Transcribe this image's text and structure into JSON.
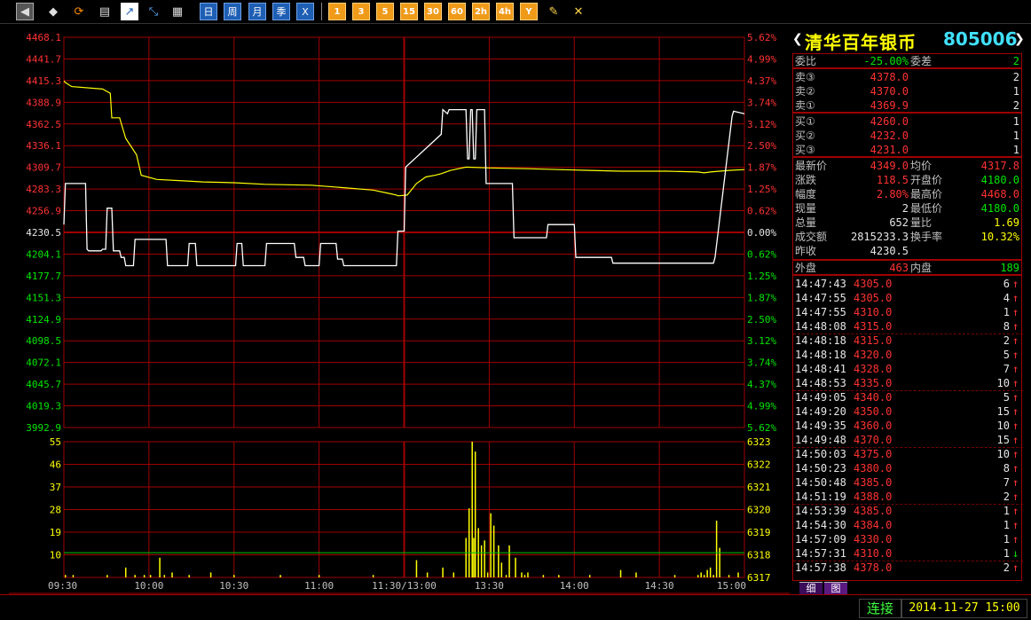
{
  "toolbar": {
    "icons": [
      "back-icon",
      "cube-icon",
      "refresh-icon",
      "clipboard-icon",
      "chart-icon",
      "compare-icon",
      "table-icon"
    ],
    "periods": [
      "日",
      "周",
      "月",
      "季",
      "X"
    ],
    "intervals": [
      "1",
      "3",
      "5",
      "15",
      "30",
      "60",
      "2h",
      "4h",
      "Y"
    ],
    "tools": [
      "pencil-icon",
      "tools-icon"
    ]
  },
  "stock": {
    "name": "清华百年银币",
    "code": "805006"
  },
  "orderbook": {
    "weibi_label": "委比",
    "weibi_value": "-25.00%",
    "weicha_label": "委差",
    "weicha_value": "2",
    "asks": [
      {
        "label": "卖③",
        "price": "4378.0",
        "qty": "2"
      },
      {
        "label": "卖②",
        "price": "4370.0",
        "qty": "1"
      },
      {
        "label": "卖①",
        "price": "4369.9",
        "qty": "2"
      }
    ],
    "bids": [
      {
        "label": "买①",
        "price": "4260.0",
        "qty": "1"
      },
      {
        "label": "买②",
        "price": "4232.0",
        "qty": "1"
      },
      {
        "label": "买③",
        "price": "4231.0",
        "qty": "1"
      }
    ]
  },
  "quote": {
    "rows": [
      {
        "l1": "最新价",
        "v1": "4349.0",
        "c1": "red",
        "l2": "均价",
        "v2": "4317.8",
        "c2": "red"
      },
      {
        "l1": "涨跌",
        "v1": "118.5",
        "c1": "red",
        "l2": "开盘价",
        "v2": "4180.0",
        "c2": "green"
      },
      {
        "l1": "幅度",
        "v1": "2.80%",
        "c1": "red",
        "l2": "最高价",
        "v2": "4468.0",
        "c2": "red"
      },
      {
        "l1": "现量",
        "v1": "2",
        "c1": "wht",
        "l2": "最低价",
        "v2": "4180.0",
        "c2": "green"
      },
      {
        "l1": "总量",
        "v1": "652",
        "c1": "wht",
        "l2": "量比",
        "v2": "1.69",
        "c2": "yel"
      },
      {
        "l1": "成交额",
        "v1": "2815233.3",
        "c1": "wht",
        "l2": "换手率",
        "v2": "10.32%",
        "c2": "yel"
      },
      {
        "l1": "昨收",
        "v1": "4230.5",
        "c1": "wht",
        "l2": "",
        "v2": "",
        "c2": "wht"
      }
    ],
    "waipan_label": "外盘",
    "waipan_value": "463",
    "neipan_label": "内盘",
    "neipan_value": "189"
  },
  "ticks": [
    {
      "time": "14:47:43",
      "price": "4305.0",
      "vol": "6",
      "dir": "↑"
    },
    {
      "time": "14:47:55",
      "price": "4305.0",
      "vol": "4",
      "dir": "↑"
    },
    {
      "time": "14:47:55",
      "price": "4310.0",
      "vol": "1",
      "dir": "↑"
    },
    {
      "time": "14:48:08",
      "price": "4315.0",
      "vol": "8",
      "dir": "↑"
    },
    {
      "time": "14:48:18",
      "price": "4315.0",
      "vol": "2",
      "dir": "↑"
    },
    {
      "time": "14:48:18",
      "price": "4320.0",
      "vol": "5",
      "dir": "↑"
    },
    {
      "time": "14:48:41",
      "price": "4328.0",
      "vol": "7",
      "dir": "↑"
    },
    {
      "time": "14:48:53",
      "price": "4335.0",
      "vol": "10",
      "dir": "↑"
    },
    {
      "time": "14:49:05",
      "price": "4340.0",
      "vol": "5",
      "dir": "↑"
    },
    {
      "time": "14:49:20",
      "price": "4350.0",
      "vol": "15",
      "dir": "↑"
    },
    {
      "time": "14:49:35",
      "price": "4360.0",
      "vol": "10",
      "dir": "↑"
    },
    {
      "time": "14:49:48",
      "price": "4370.0",
      "vol": "15",
      "dir": "↑"
    },
    {
      "time": "14:50:03",
      "price": "4375.0",
      "vol": "10",
      "dir": "↑"
    },
    {
      "time": "14:50:23",
      "price": "4380.0",
      "vol": "8",
      "dir": "↑"
    },
    {
      "time": "14:50:48",
      "price": "4385.0",
      "vol": "7",
      "dir": "↑"
    },
    {
      "time": "14:51:19",
      "price": "4388.0",
      "vol": "2",
      "dir": "↑"
    },
    {
      "time": "14:53:39",
      "price": "4385.0",
      "vol": "1",
      "dir": "↑"
    },
    {
      "time": "14:54:30",
      "price": "4384.0",
      "vol": "1",
      "dir": "↑"
    },
    {
      "time": "14:57:09",
      "price": "4330.0",
      "vol": "1",
      "dir": "↑"
    },
    {
      "time": "14:57:31",
      "price": "4310.0",
      "vol": "1",
      "dir": "↓"
    },
    {
      "time": "14:57:38",
      "price": "4378.0",
      "vol": "2",
      "dir": "↑"
    }
  ],
  "tabs": [
    "细",
    "图"
  ],
  "status": {
    "connect": "连接",
    "datetime": "2014-11-27 15:00"
  },
  "colors": {
    "grid": "#a00000",
    "up": "#ff3232",
    "down": "#00e600",
    "price_line": "#ffffff",
    "avg_line": "#ffff00",
    "volume": "#ffff00",
    "vol_ref": "#00c800"
  },
  "chart_data": {
    "type": "line",
    "price_axis_left": [
      "4468.1",
      "4441.7",
      "4415.3",
      "4388.9",
      "4362.5",
      "4336.1",
      "4309.7",
      "4283.3",
      "4256.9",
      "4230.5",
      "4204.1",
      "4177.7",
      "4151.3",
      "4124.9",
      "4098.5",
      "4072.1",
      "4045.7",
      "4019.3",
      "3992.9"
    ],
    "pct_axis_right": [
      "5.62%",
      "4.99%",
      "4.37%",
      "3.74%",
      "3.12%",
      "2.50%",
      "1.87%",
      "1.25%",
      "0.62%",
      "0.00%",
      "0.62%",
      "1.25%",
      "1.87%",
      "2.50%",
      "3.12%",
      "3.74%",
      "4.37%",
      "4.99%",
      "5.62%"
    ],
    "ylim": [
      3992.9,
      4468.1
    ],
    "prev_close": 4230.5,
    "time_labels": [
      "09:30",
      "10:00",
      "10:30",
      "11:00",
      "11:30/13:00",
      "13:30",
      "14:00",
      "14:30",
      "15:00"
    ],
    "price_series": {
      "x": [
        0,
        1,
        14,
        15,
        16,
        24,
        25,
        27,
        28,
        31,
        32,
        36,
        37,
        39,
        40,
        45,
        46,
        66,
        67,
        70,
        71,
        80,
        81,
        85,
        86,
        89,
        90,
        111,
        112,
        115,
        116,
        127,
        128,
        130,
        131,
        149,
        150,
        155,
        156,
        165,
        166,
        176,
        177,
        180,
        181,
        215,
        216,
        220,
        221,
        244,
        245,
        248,
        249,
        260,
        261,
        262,
        263,
        264,
        265,
        266,
        267,
        272,
        273,
        290,
        291,
        312,
        313,
        330,
        331,
        354,
        355,
        390,
        391,
        395,
        396,
        410,
        411,
        414,
        415,
        420,
        421,
        432,
        433,
        440
      ],
      "y": [
        4240,
        4290,
        4290,
        4210,
        4208,
        4208,
        4210,
        4210,
        4260,
        4260,
        4208,
        4208,
        4200,
        4200,
        4190,
        4190,
        4222,
        4222,
        4190,
        4190,
        4190,
        4190,
        4217,
        4217,
        4190,
        4190,
        4190,
        4190,
        4217,
        4217,
        4190,
        4190,
        4190,
        4190,
        4217,
        4217,
        4200,
        4200,
        4190,
        4190,
        4217,
        4217,
        4198,
        4198,
        4190,
        4190,
        4232,
        4232,
        4310,
        4350,
        4380,
        4375,
        4380,
        4380,
        4320,
        4320,
        4380,
        4380,
        4320,
        4320,
        4380,
        4380,
        4290,
        4290,
        4224,
        4224,
        4240,
        4240,
        4200,
        4200,
        4193,
        4193,
        4193,
        4193,
        4193,
        4193,
        4193,
        4193,
        4193,
        4193,
        4200,
        4372,
        4378,
        4375
      ]
    },
    "avg_series": {
      "x": [
        0,
        1,
        5,
        25,
        30,
        31,
        36,
        40,
        47,
        50,
        60,
        80,
        90,
        110,
        130,
        160,
        180,
        200,
        210,
        215,
        216,
        222,
        228,
        234,
        240,
        244,
        250,
        260,
        275,
        300,
        320,
        340,
        360,
        390,
        410,
        414,
        418,
        430,
        440
      ],
      "y": [
        4415,
        4413,
        4408,
        4405,
        4400,
        4370,
        4370,
        4345,
        4325,
        4300,
        4295,
        4293,
        4292,
        4291,
        4289,
        4288,
        4285,
        4282,
        4278,
        4276,
        4275,
        4276,
        4290,
        4298,
        4300,
        4302,
        4306,
        4310,
        4309,
        4308,
        4307,
        4306,
        4305,
        4305,
        4304,
        4303,
        4304,
        4306,
        4307
      ],
      "name": ""
    },
    "volume_axis_left": [
      "55",
      "46",
      "37",
      "28",
      "19",
      "10"
    ],
    "volume_axis_right": [
      "6323",
      "6322",
      "6321",
      "6320",
      "6319",
      "6318",
      "6317"
    ],
    "volume_ylim": [
      0,
      55
    ],
    "volume_ref": 10,
    "volume": {
      "x": [
        1,
        6,
        28,
        40,
        46,
        52,
        56,
        62,
        65,
        70,
        81,
        95,
        110,
        140,
        165,
        200,
        228,
        235,
        245,
        252,
        260,
        262,
        264,
        265,
        266,
        268,
        270,
        272,
        274,
        276,
        278,
        281,
        283,
        286,
        288,
        292,
        296,
        298,
        300,
        310,
        320,
        340,
        360,
        370,
        395,
        410,
        412,
        414,
        416,
        418,
        420,
        422,
        424,
        430,
        436
      ],
      "y": [
        1,
        1,
        1,
        4,
        1,
        1,
        1,
        8,
        1,
        2,
        1,
        2,
        1,
        1,
        1,
        1,
        7,
        2,
        4,
        2,
        16,
        28,
        55,
        16,
        51,
        20,
        13,
        15,
        2,
        26,
        21,
        13,
        6,
        1,
        13,
        8,
        2,
        1,
        2,
        1,
        1,
        1,
        3,
        2,
        1,
        1,
        2,
        1,
        3,
        4,
        1,
        23,
        12,
        1,
        2
      ]
    }
  }
}
